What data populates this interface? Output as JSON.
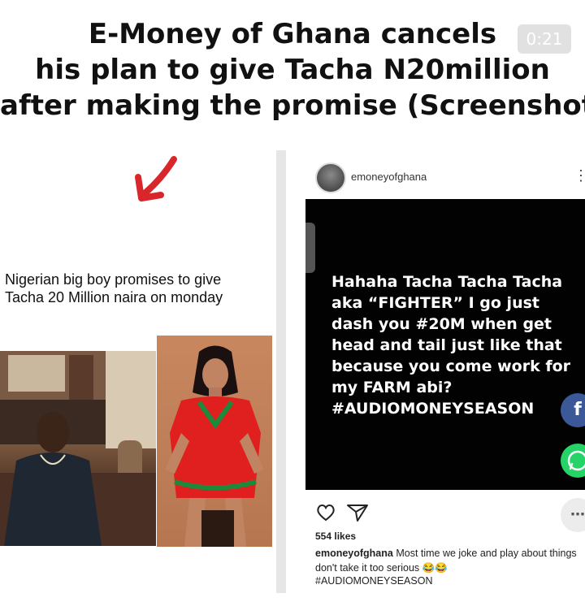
{
  "headline": {
    "line1": "E-Money of Ghana cancels",
    "line2": "his plan to give Tacha N20million",
    "line3": "after making the promise (Screenshot)"
  },
  "video": {
    "timer": "0:21"
  },
  "left": {
    "caption_line1": "Nigerian big boy promises to give",
    "caption_line2": "Tacha 20 Million naira on monday"
  },
  "instagram": {
    "username": "emoneyofghana",
    "post_lines": [
      "Hahaha Tacha Tacha Tacha",
      "aka  “FIGHTER” I go just",
      "dash you #20M when get",
      "head and tail just like that",
      "because you come work for",
      "my FARM abi?",
      "#AUDIOMONEYSEASON"
    ],
    "likes": "554 likes",
    "comment_user": "emoneyofghana",
    "comment_text": " Most time we joke and play about things don't take it too serious 😂😂",
    "hashtag": "#AUDIOMONEYSEASON"
  },
  "colors": {
    "facebook": "#3b5998",
    "whatsapp": "#25d366",
    "arrow": "#d8262b",
    "post_bg": "#020202"
  },
  "icons": [
    "arrow-icon",
    "heart-icon",
    "share-icon",
    "facebook-icon",
    "whatsapp-icon",
    "more-icon"
  ]
}
